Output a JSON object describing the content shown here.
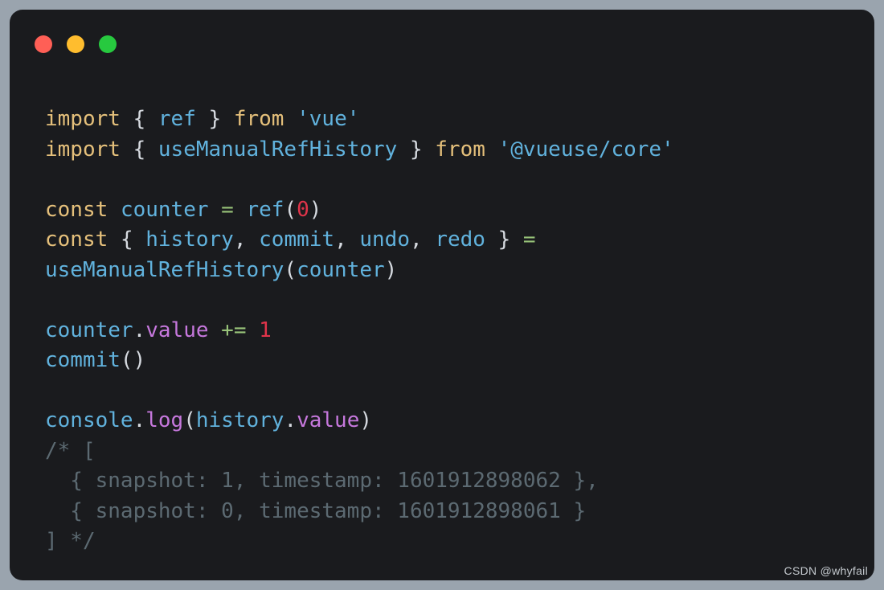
{
  "window": {
    "background_color": "#1a1b1e",
    "page_background_color": "#9aa4ae",
    "traffic_lights": [
      {
        "name": "close",
        "color": "#ff5f56"
      },
      {
        "name": "minimize",
        "color": "#ffbd2e"
      },
      {
        "name": "maximize",
        "color": "#27c93f"
      }
    ]
  },
  "theme": {
    "keyword": "#e5c07b",
    "identifier": "#61b2dd",
    "string": "#61b2dd",
    "punctuation": "#d6dae0",
    "operator": "#98c379",
    "number": "#e0344a",
    "property": "#c678dd",
    "comment": "#5c6a72"
  },
  "code": {
    "language": "javascript",
    "plain_text": "import { ref } from 'vue'\nimport { useManualRefHistory } from '@vueuse/core'\n\nconst counter = ref(0)\nconst { history, commit, undo, redo } =\nuseManualRefHistory(counter)\n\ncounter.value += 1\ncommit()\n\nconsole.log(history.value)\n/* [\n  { snapshot: 1, timestamp: 1601912898062 },\n  { snapshot: 0, timestamp: 1601912898061 }\n] */",
    "lines": [
      {
        "n": 1,
        "tokens": [
          {
            "text": "import",
            "type": "kw"
          },
          {
            "text": " ",
            "type": "punc"
          },
          {
            "text": "{",
            "type": "punc"
          },
          {
            "text": " ",
            "type": "punc"
          },
          {
            "text": "ref",
            "type": "id"
          },
          {
            "text": " ",
            "type": "punc"
          },
          {
            "text": "}",
            "type": "punc"
          },
          {
            "text": " ",
            "type": "punc"
          },
          {
            "text": "from",
            "type": "kw"
          },
          {
            "text": " ",
            "type": "punc"
          },
          {
            "text": "'vue'",
            "type": "str"
          }
        ]
      },
      {
        "n": 2,
        "tokens": [
          {
            "text": "import",
            "type": "kw"
          },
          {
            "text": " ",
            "type": "punc"
          },
          {
            "text": "{",
            "type": "punc"
          },
          {
            "text": " ",
            "type": "punc"
          },
          {
            "text": "useManualRefHistory",
            "type": "id"
          },
          {
            "text": " ",
            "type": "punc"
          },
          {
            "text": "}",
            "type": "punc"
          },
          {
            "text": " ",
            "type": "punc"
          },
          {
            "text": "from",
            "type": "kw"
          },
          {
            "text": " ",
            "type": "punc"
          },
          {
            "text": "'@vueuse/core'",
            "type": "str"
          }
        ]
      },
      {
        "n": 3,
        "tokens": []
      },
      {
        "n": 4,
        "tokens": [
          {
            "text": "const",
            "type": "kw"
          },
          {
            "text": " ",
            "type": "punc"
          },
          {
            "text": "counter",
            "type": "id"
          },
          {
            "text": " ",
            "type": "punc"
          },
          {
            "text": "=",
            "type": "op"
          },
          {
            "text": " ",
            "type": "punc"
          },
          {
            "text": "ref",
            "type": "id"
          },
          {
            "text": "(",
            "type": "punc"
          },
          {
            "text": "0",
            "type": "num"
          },
          {
            "text": ")",
            "type": "punc"
          }
        ]
      },
      {
        "n": 5,
        "tokens": [
          {
            "text": "const",
            "type": "kw"
          },
          {
            "text": " ",
            "type": "punc"
          },
          {
            "text": "{",
            "type": "punc"
          },
          {
            "text": " ",
            "type": "punc"
          },
          {
            "text": "history",
            "type": "id"
          },
          {
            "text": ",",
            "type": "punc"
          },
          {
            "text": " ",
            "type": "punc"
          },
          {
            "text": "commit",
            "type": "id"
          },
          {
            "text": ",",
            "type": "punc"
          },
          {
            "text": " ",
            "type": "punc"
          },
          {
            "text": "undo",
            "type": "id"
          },
          {
            "text": ",",
            "type": "punc"
          },
          {
            "text": " ",
            "type": "punc"
          },
          {
            "text": "redo",
            "type": "id"
          },
          {
            "text": " ",
            "type": "punc"
          },
          {
            "text": "}",
            "type": "punc"
          },
          {
            "text": " ",
            "type": "punc"
          },
          {
            "text": "=",
            "type": "op"
          }
        ]
      },
      {
        "n": 6,
        "tokens": [
          {
            "text": "useManualRefHistory",
            "type": "id"
          },
          {
            "text": "(",
            "type": "punc"
          },
          {
            "text": "counter",
            "type": "id"
          },
          {
            "text": ")",
            "type": "punc"
          }
        ]
      },
      {
        "n": 7,
        "tokens": []
      },
      {
        "n": 8,
        "tokens": [
          {
            "text": "counter",
            "type": "id"
          },
          {
            "text": ".",
            "type": "punc"
          },
          {
            "text": "value",
            "type": "prop"
          },
          {
            "text": " ",
            "type": "punc"
          },
          {
            "text": "+=",
            "type": "op"
          },
          {
            "text": " ",
            "type": "punc"
          },
          {
            "text": "1",
            "type": "num"
          }
        ]
      },
      {
        "n": 9,
        "tokens": [
          {
            "text": "commit",
            "type": "id"
          },
          {
            "text": "()",
            "type": "punc"
          }
        ]
      },
      {
        "n": 10,
        "tokens": []
      },
      {
        "n": 11,
        "tokens": [
          {
            "text": "console",
            "type": "id"
          },
          {
            "text": ".",
            "type": "punc"
          },
          {
            "text": "log",
            "type": "prop"
          },
          {
            "text": "(",
            "type": "punc"
          },
          {
            "text": "history",
            "type": "id"
          },
          {
            "text": ".",
            "type": "punc"
          },
          {
            "text": "value",
            "type": "prop"
          },
          {
            "text": ")",
            "type": "punc"
          }
        ]
      },
      {
        "n": 12,
        "tokens": [
          {
            "text": "/* [",
            "type": "comment"
          }
        ]
      },
      {
        "n": 13,
        "tokens": [
          {
            "text": "  { snapshot: 1, timestamp: 1601912898062 },",
            "type": "comment"
          }
        ]
      },
      {
        "n": 14,
        "tokens": [
          {
            "text": "  { snapshot: 0, timestamp: 1601912898061 }",
            "type": "comment"
          }
        ]
      },
      {
        "n": 15,
        "tokens": [
          {
            "text": "] */",
            "type": "comment"
          }
        ]
      }
    ]
  },
  "console_output": {
    "history": [
      {
        "snapshot": 1,
        "timestamp": 1601912898062
      },
      {
        "snapshot": 0,
        "timestamp": 1601912898061
      }
    ]
  },
  "watermark": {
    "text": "CSDN @whyfail"
  }
}
